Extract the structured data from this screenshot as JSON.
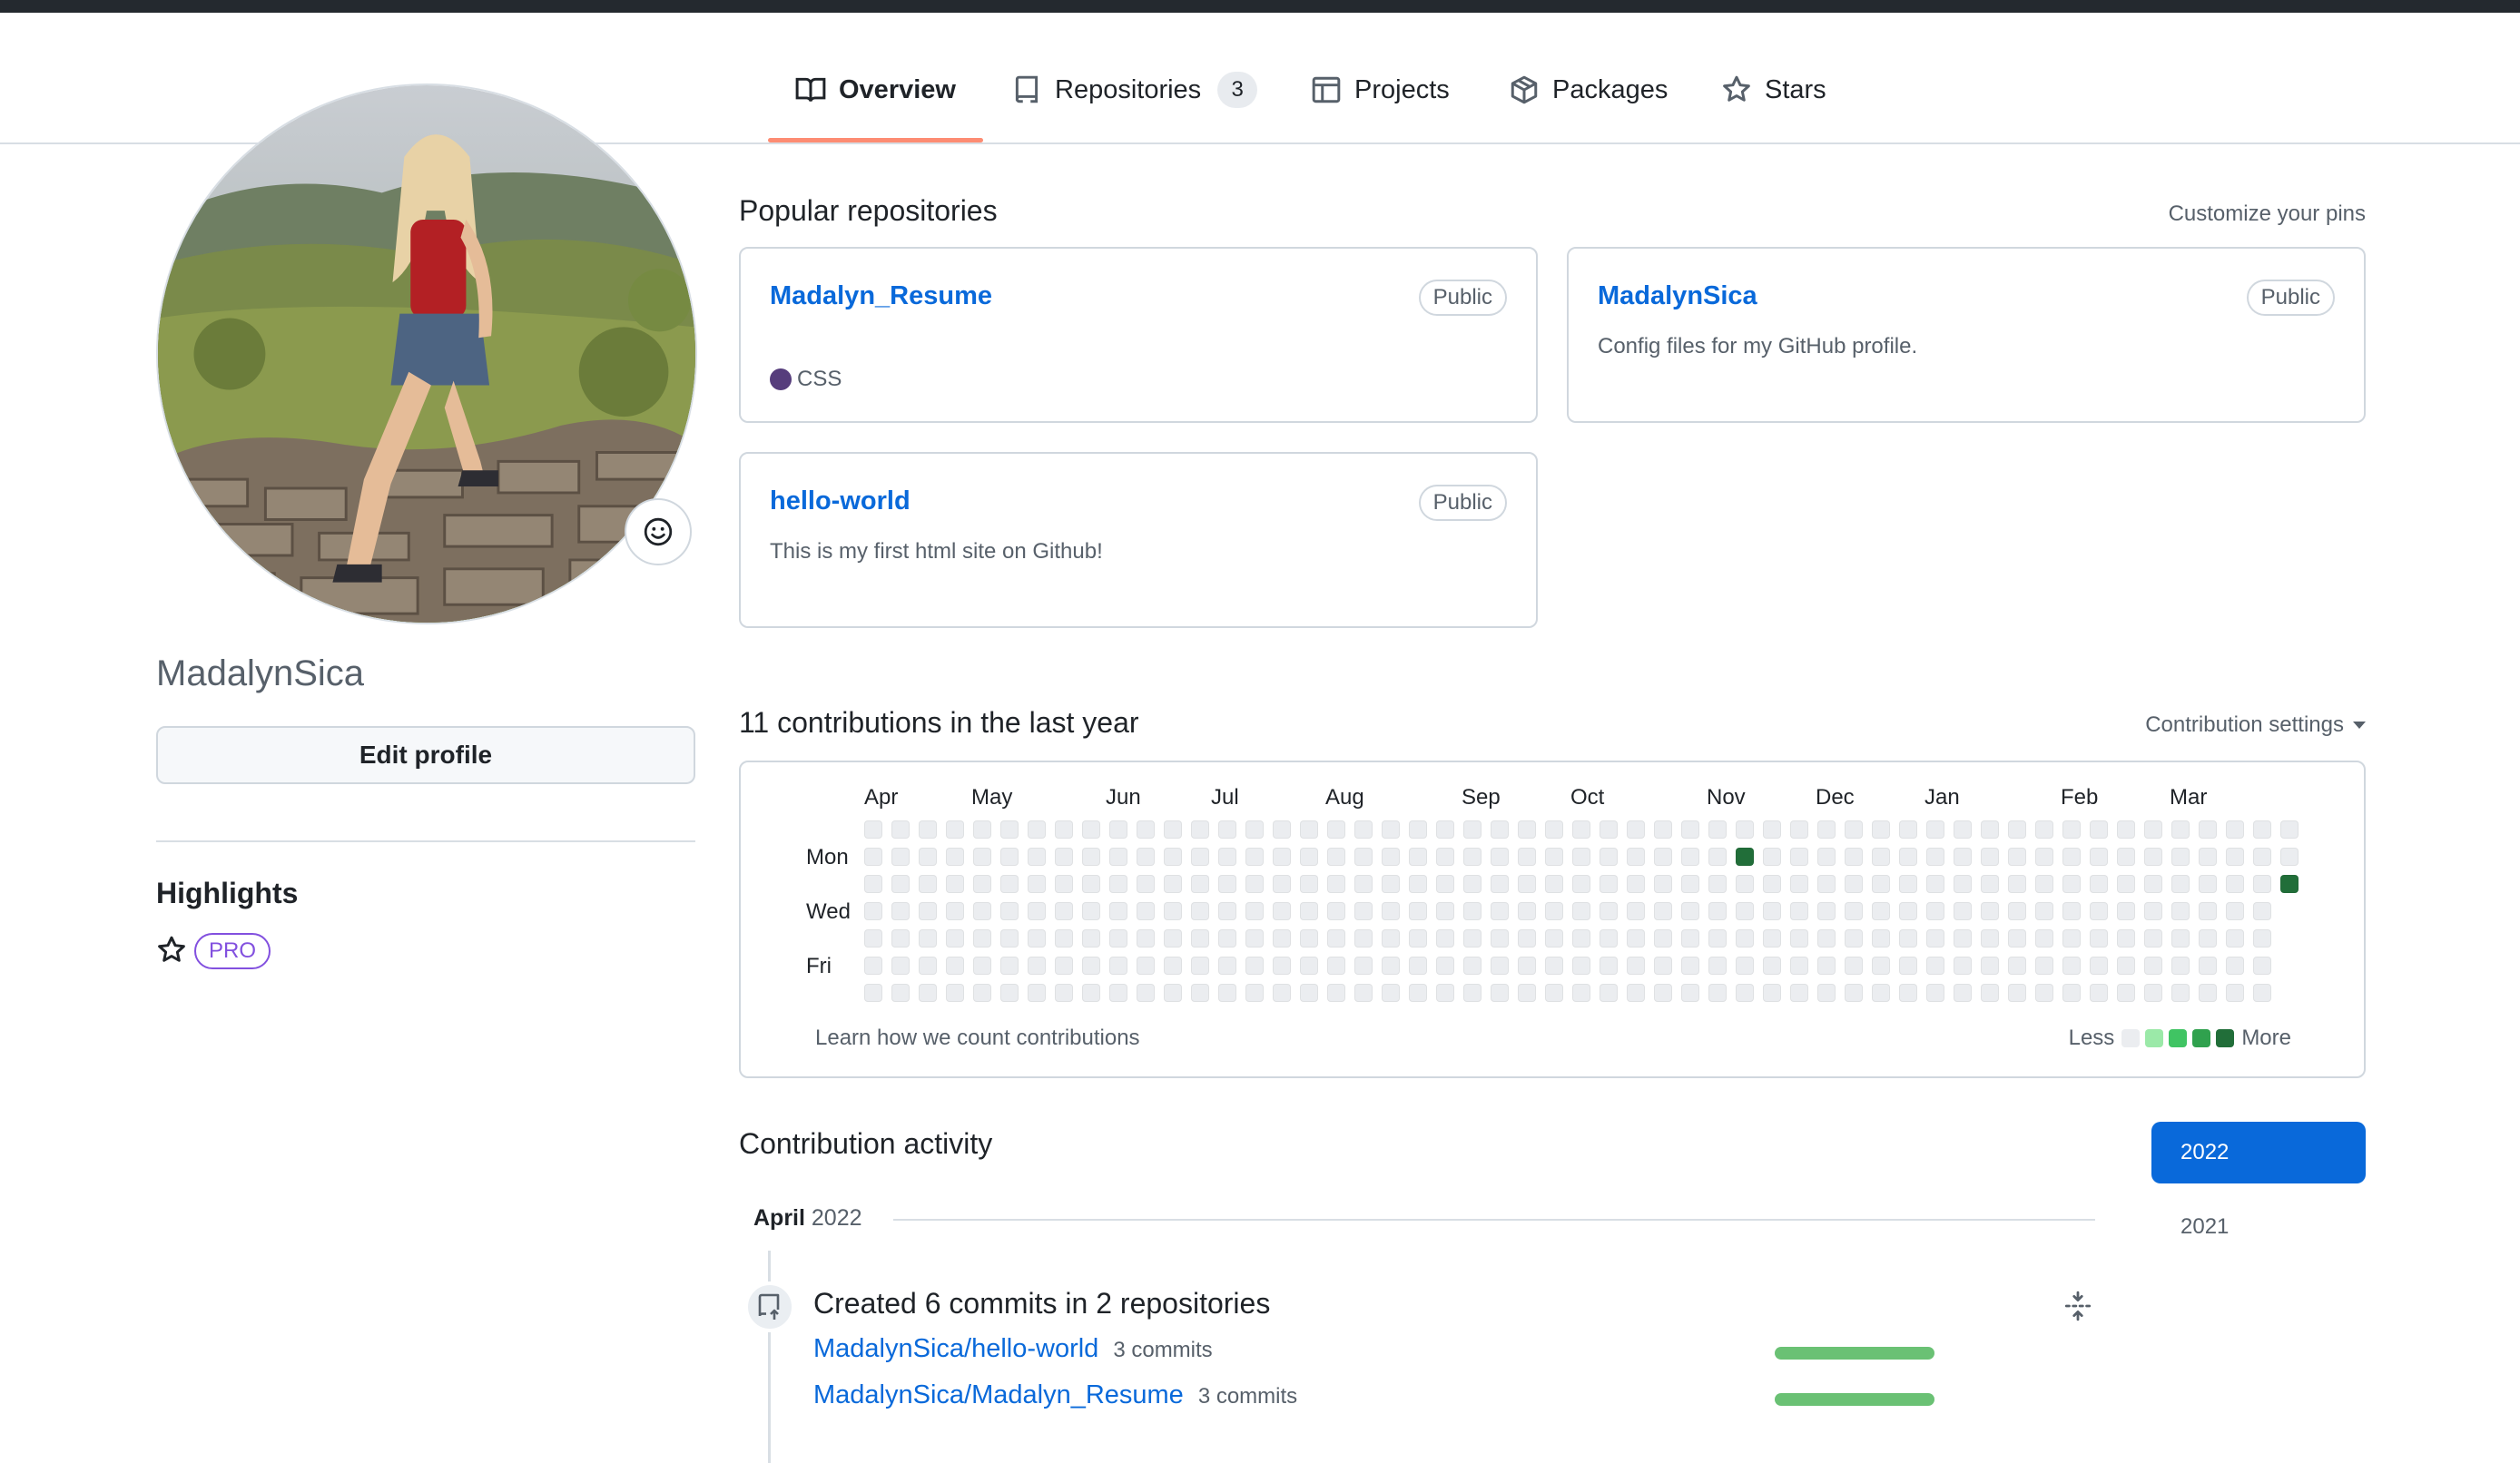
{
  "tabs": [
    {
      "label": "Overview",
      "icon": "book-icon",
      "active": true
    },
    {
      "label": "Repositories",
      "icon": "repo-icon",
      "count": "3"
    },
    {
      "label": "Projects",
      "icon": "table-icon"
    },
    {
      "label": "Packages",
      "icon": "package-icon"
    },
    {
      "label": "Stars",
      "icon": "star-icon"
    }
  ],
  "profile": {
    "username": "MadalynSica",
    "edit_label": "Edit profile",
    "highlights_title": "Highlights",
    "pro_badge": "PRO"
  },
  "popular": {
    "title": "Popular repositories",
    "customize": "Customize your pins",
    "repos": [
      {
        "name": "Madalyn_Resume",
        "visibility": "Public",
        "language": "CSS",
        "language_color": "#563d7c",
        "description": ""
      },
      {
        "name": "MadalynSica",
        "visibility": "Public",
        "description": "Config files for my GitHub profile."
      },
      {
        "name": "hello-world",
        "visibility": "Public",
        "description": "This is my first html site on Github!"
      }
    ]
  },
  "contributions": {
    "title": "11 contributions in the last year",
    "settings": "Contribution settings",
    "months": [
      "Apr",
      "May",
      "Jun",
      "Jul",
      "Aug",
      "Sep",
      "Oct",
      "Nov",
      "Dec",
      "Jan",
      "Feb",
      "Mar"
    ],
    "days": [
      "Mon",
      "Wed",
      "Fri"
    ],
    "learn": "Learn how we count contributions",
    "less": "Less",
    "more": "More",
    "colors": [
      "#ebedf0",
      "#9be9a8",
      "#40c463",
      "#30a14e",
      "#216e39"
    ]
  },
  "activity": {
    "title": "Contribution activity",
    "month": "April",
    "year": "2022",
    "years": [
      "2022",
      "2021"
    ],
    "commit_summary": "Created 6 commits in 2 repositories",
    "commits": [
      {
        "repo": "MadalynSica/hello-world",
        "count": "3 commits"
      },
      {
        "repo": "MadalynSica/Madalyn_Resume",
        "count": "3 commits"
      }
    ]
  }
}
